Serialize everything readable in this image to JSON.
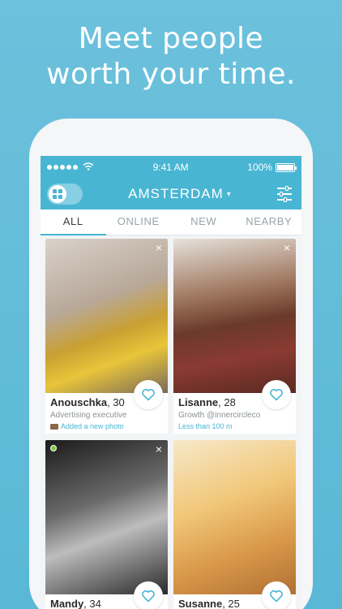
{
  "headline": {
    "line1": "Meet people",
    "line2": "worth your time."
  },
  "statusbar": {
    "time": "9:41 AM",
    "battery": "100%"
  },
  "navbar": {
    "city": "AMSTERDAM",
    "city_chevron": "▾"
  },
  "tabs": [
    {
      "label": "ALL",
      "active": true
    },
    {
      "label": "ONLINE",
      "active": false
    },
    {
      "label": "NEW",
      "active": false
    },
    {
      "label": "NEARBY",
      "active": false
    }
  ],
  "profiles": [
    {
      "name": "Anouschka",
      "age": ", 30",
      "job": "Advertising executive",
      "activity": "Added a new photo",
      "close": "×",
      "online": false
    },
    {
      "name": "Lisanne",
      "age": ", 28",
      "job": "Growth @innercircleco",
      "activity": "Less than 100 m",
      "close": "×",
      "online": false
    },
    {
      "name": "Mandy",
      "age": ", 34",
      "job": "",
      "activity": "",
      "close": "×",
      "online": true
    },
    {
      "name": "Susanne",
      "age": ", 25",
      "job": "",
      "activity": "",
      "close": "",
      "online": false
    }
  ],
  "colors": {
    "accent": "#48b5d3",
    "background": "#6cc1dc",
    "online": "#7ccb3c"
  },
  "icons": [
    "grid-icon",
    "filter-icon",
    "wifi-icon",
    "battery-icon",
    "heart-icon",
    "close-icon",
    "camera-icon"
  ]
}
